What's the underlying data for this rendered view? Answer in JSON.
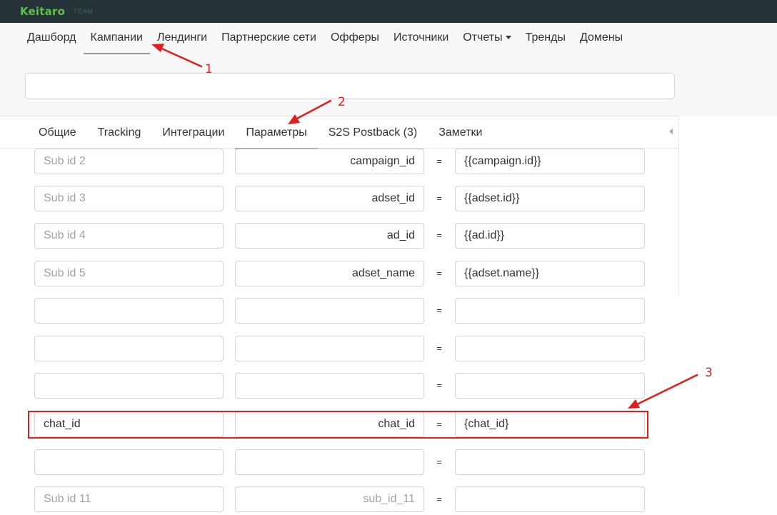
{
  "brand": {
    "name": "Keitaro",
    "edition": "TEAM",
    "color": "#5fc046"
  },
  "main_nav": [
    {
      "label": "Дашборд",
      "active": false
    },
    {
      "label": "Кампании",
      "active": true
    },
    {
      "label": "Лендинги",
      "active": false
    },
    {
      "label": "Партнерские сети",
      "active": false
    },
    {
      "label": "Офферы",
      "active": false
    },
    {
      "label": "Источники",
      "active": false
    },
    {
      "label": "Отчеты",
      "active": false,
      "dropdown": true
    },
    {
      "label": "Тренды",
      "active": false
    },
    {
      "label": "Домены",
      "active": false
    }
  ],
  "search": {
    "value": "",
    "placeholder": ""
  },
  "tabs": [
    {
      "label": "Общие",
      "active": false
    },
    {
      "label": "Tracking",
      "active": false
    },
    {
      "label": "Интеграции",
      "active": false
    },
    {
      "label": "Параметры",
      "active": true
    },
    {
      "label": "S2S Postback (3)",
      "active": false
    },
    {
      "label": "Заметки",
      "active": false
    }
  ],
  "params": {
    "equals_sign": "=",
    "rows": [
      {
        "name": "",
        "name_placeholder": "Sub id 2",
        "key": "campaign_id",
        "value": "{{campaign.id}}"
      },
      {
        "name": "",
        "name_placeholder": "Sub id 3",
        "key": "adset_id",
        "value": "{{adset.id}}"
      },
      {
        "name": "",
        "name_placeholder": "Sub id 4",
        "key": "ad_id",
        "value": "{{ad.id}}"
      },
      {
        "name": "",
        "name_placeholder": "Sub id 5",
        "key": "adset_name",
        "value": "{{adset.name}}"
      },
      {
        "name": "",
        "name_placeholder": "",
        "key": "",
        "value": ""
      },
      {
        "name": "",
        "name_placeholder": "",
        "key": "",
        "value": ""
      },
      {
        "name": "",
        "name_placeholder": "",
        "key": "",
        "value": ""
      },
      {
        "name": "chat_id",
        "name_placeholder": "",
        "key": "chat_id",
        "value": "{chat_id}",
        "highlighted": true
      },
      {
        "name": "",
        "name_placeholder": "",
        "key": "",
        "value": ""
      },
      {
        "name": "",
        "name_placeholder": "Sub id 11",
        "key": "",
        "key_placeholder": "sub_id_11",
        "value": ""
      }
    ]
  },
  "annotations": {
    "label_1": "1",
    "label_2": "2",
    "label_3": "3",
    "color": "#e01e1e"
  }
}
